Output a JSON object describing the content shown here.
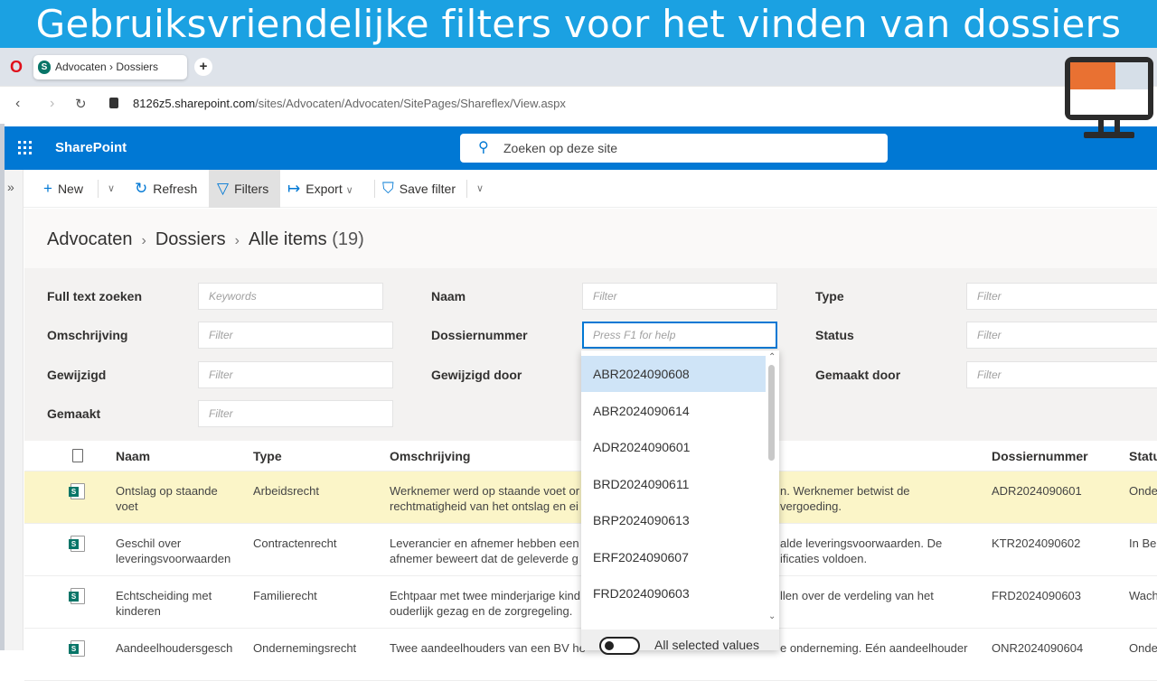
{
  "banner": {
    "title": "Gebruiksvriendelijke filters voor het vinden van dossiers"
  },
  "browser": {
    "tab_title": "Advocaten › Dossiers",
    "url_host": "8126z5.sharepoint.com",
    "url_path": "/sites/Advocaten/Advocaten/SitePages/Shareflex/View.aspx"
  },
  "header": {
    "app_name": "SharePoint",
    "search_placeholder": "Zoeken op deze site"
  },
  "commandbar": {
    "new": "New",
    "refresh": "Refresh",
    "filters": "Filters",
    "export": "Export",
    "save_filter": "Save filter"
  },
  "breadcrumb": {
    "site": "Advocaten",
    "list": "Dossiers",
    "view": "Alle items",
    "count": "(19)"
  },
  "filters": [
    {
      "label": "Full text zoeken",
      "placeholder": "Keywords"
    },
    {
      "label": "Naam",
      "placeholder": "Filter"
    },
    {
      "label": "Type",
      "placeholder": "Filter"
    },
    {
      "label": "Omschrijving",
      "placeholder": "Filter"
    },
    {
      "label": "Dossiernummer",
      "placeholder": "Press F1 for help"
    },
    {
      "label": "Status",
      "placeholder": "Filter"
    },
    {
      "label": "Gewijzigd",
      "placeholder": "Filter"
    },
    {
      "label": "Gewijzigd door",
      "placeholder": ""
    },
    {
      "label": "Gemaakt door",
      "placeholder": "Filter"
    },
    {
      "label": "Gemaakt",
      "placeholder": "Filter"
    }
  ],
  "dropdown": {
    "options": [
      "ABR2024090608",
      "ABR2024090614",
      "ADR2024090601",
      "BRD2024090611",
      "BRP2024090613",
      "ERF2024090607",
      "FRD2024090603"
    ],
    "highlighted": "ABR2024090608",
    "toggle_label": "All selected values"
  },
  "table": {
    "columns": [
      "Naam",
      "Type",
      "Omschrijving",
      "Dossiernummer",
      "Status"
    ],
    "rows": [
      {
        "naam": "Ontslag op staande\nvoet",
        "type": "Arbeidsrecht",
        "omschr_a": "Werknemer werd op staande voet or\nrechtmatigheid van het ontslag en ei",
        "omschr_b": "n. Werknemer betwist de\nvergoeding.",
        "nummer": "ADR2024090601",
        "status": "Onde"
      },
      {
        "naam": "Geschil over\nleveringsvoorwaarden",
        "type": "Contractenrecht",
        "omschr_a": "Leverancier en afnemer hebben een\nafnemer beweert dat de geleverde g",
        "omschr_b": "alde leveringsvoorwaarden. De\nificaties voldoen.",
        "nummer": "KTR2024090602",
        "status": "In Bel"
      },
      {
        "naam": "Echtscheiding met\nkinderen",
        "type": "Familierecht",
        "omschr_a": "Echtpaar met twee minderjarige kind\nouderlijk gezag en de zorgregeling.",
        "omschr_b": "llen over de verdeling van het",
        "nummer": "FRD2024090603",
        "status": "Wach"
      },
      {
        "naam": "Aandeelhoudersgesch",
        "type": "Ondernemingsrecht",
        "omschr_a": "Twee aandeelhouders van een BV he",
        "omschr_b": "e onderneming. Eén aandeelhouder",
        "nummer": "ONR2024090604",
        "status": "Onde"
      }
    ]
  },
  "colors": {
    "banner": "#1ba1e2",
    "suite_bar": "#0078d4",
    "selected_row": "#fbf5c8",
    "dropdown_highlight": "#cfe4f7",
    "monitor_accent": "#e97132"
  }
}
